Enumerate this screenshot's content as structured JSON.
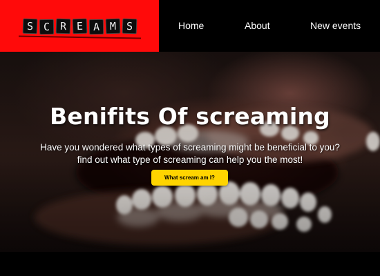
{
  "logo": {
    "letters": [
      "S",
      "C",
      "R",
      "E",
      "A",
      "M",
      "S"
    ]
  },
  "nav": {
    "items": [
      {
        "label": "Home"
      },
      {
        "label": "About"
      },
      {
        "label": "New events"
      }
    ]
  },
  "hero": {
    "title": "Benifits Of screaming",
    "subtitle_line1": "Have you wondered what types of screaming might be beneficial to you?",
    "subtitle_line2": "find out what type of screaming can help you the most!",
    "cta_label": "What scream am I?"
  },
  "colors": {
    "logo_background": "#ff0a0a",
    "nav_background": "#000000",
    "cta_background": "#ffd400"
  }
}
